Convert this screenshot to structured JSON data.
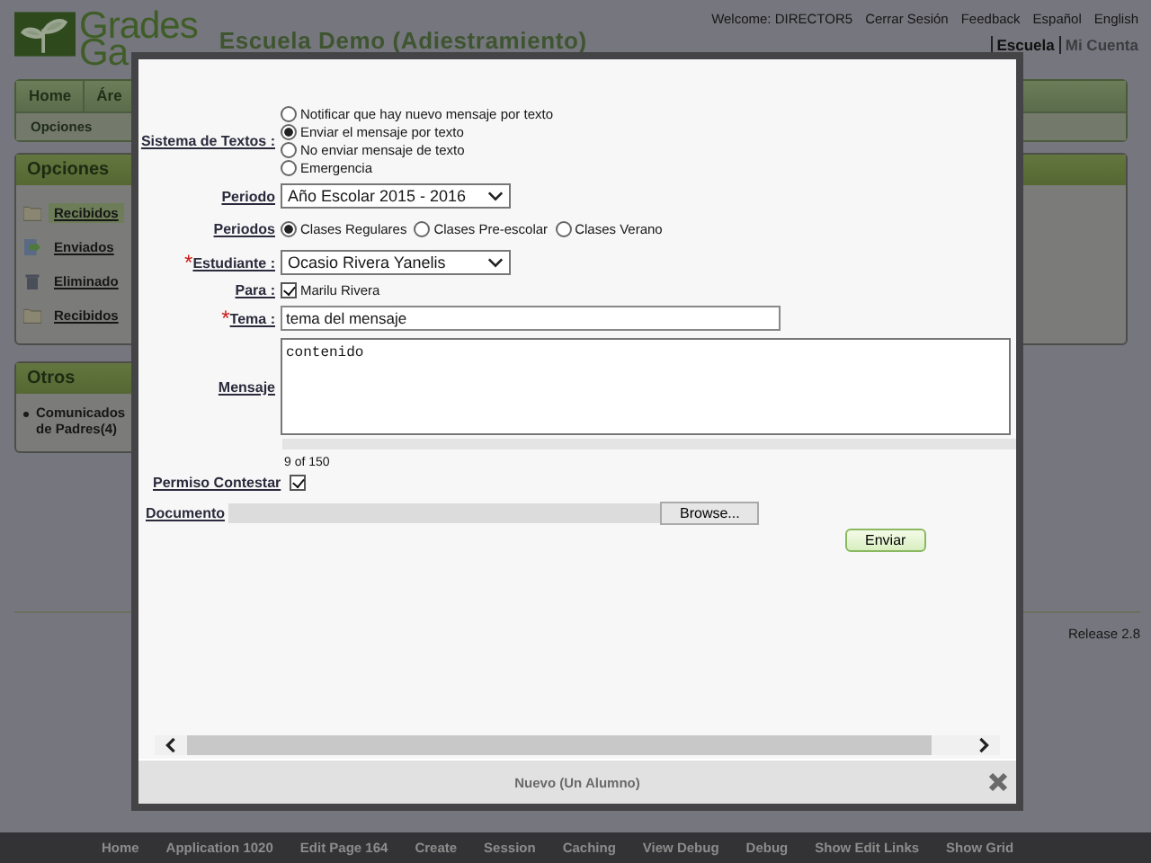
{
  "header": {
    "logo_lines": [
      "Grades",
      "Ga"
    ],
    "school_title": "Escuela Demo (Adiestramiento)",
    "welcome": "Welcome: DIRECTOR5",
    "top_links": [
      "Cerrar Sesión",
      "Feedback",
      "Español",
      "English"
    ],
    "account_links": [
      {
        "label": "Escuela",
        "selected": true
      },
      {
        "label": "Mi Cuenta",
        "selected": false
      }
    ]
  },
  "nav": {
    "tabs": [
      "Home",
      "Áre"
    ],
    "sub_items": [
      "Opciones"
    ]
  },
  "sidebar": {
    "panels": [
      {
        "kind": "icon_list",
        "title": "Opciones",
        "items": [
          {
            "label": "Recibidos",
            "kind": "folder",
            "selected": true
          },
          {
            "label": "Enviados",
            "kind": "send",
            "selected": false
          },
          {
            "label": "Eliminado",
            "kind": "trash",
            "selected": false
          },
          {
            "label": "Recibidos",
            "kind": "folder",
            "selected": false
          }
        ]
      },
      {
        "kind": "bullet_list",
        "title": "Otros",
        "items": [
          {
            "label": "Comunicados de Padres(4)"
          }
        ]
      }
    ]
  },
  "release": "Release 2.8",
  "modal": {
    "fields": [
      {
        "kind": "radio_list",
        "label": "Sistema de Textos :",
        "options": [
          {
            "label": "Notificar que hay nuevo mensaje por texto",
            "selected": false
          },
          {
            "label": "Enviar el mensaje por texto",
            "selected": true
          },
          {
            "label": "No enviar mensaje de texto",
            "selected": false
          },
          {
            "label": "Emergencia",
            "selected": false
          }
        ]
      },
      {
        "kind": "select",
        "label": "Periodo",
        "value": "Año Escolar 2015 - 2016"
      },
      {
        "kind": "radio_row",
        "label": "Periodos",
        "options": [
          {
            "label": "Clases Regulares",
            "selected": true
          },
          {
            "label": "Clases Pre-escolar",
            "selected": false
          },
          {
            "label": "Clases Verano",
            "selected": false
          }
        ]
      },
      {
        "kind": "select",
        "marker": "*",
        "label": "Estudiante :",
        "value": "Ocasio Rivera Yanelis"
      },
      {
        "kind": "checkbox",
        "label": "Para :",
        "option": "Marilu Rivera",
        "checked": true
      },
      {
        "kind": "text",
        "marker": "*",
        "label": "Tema :",
        "value": "tema del mensaje"
      },
      {
        "kind": "textarea",
        "label": "Mensaje",
        "value": "contenido"
      }
    ],
    "counter": "9 of 150",
    "permission": {
      "label": "Permiso Contestar",
      "checked": true
    },
    "document": {
      "label": "Documento",
      "button": "Browse..."
    },
    "submit": "Enviar",
    "footer_title": "Nuevo (Un Alumno)"
  },
  "footer_links": [
    "Home",
    "Application 1020",
    "Edit Page 164",
    "Create",
    "Session",
    "Caching",
    "View Debug",
    "Debug",
    "Show Edit Links",
    "Show Grid"
  ]
}
